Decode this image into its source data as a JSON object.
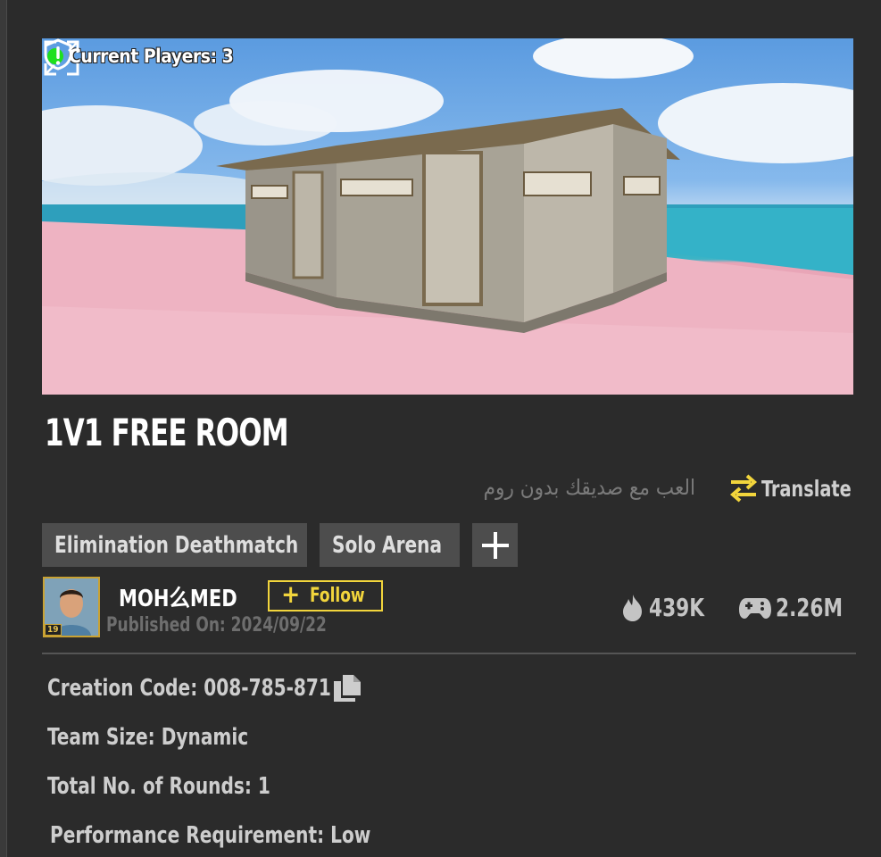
{
  "preview": {
    "current_players_label": "Current Players: 3",
    "status_color": "#1ee01e"
  },
  "room": {
    "title": "1V1 FREE ROOM",
    "description": "العب مع صديقك بدون روم",
    "translate_label": "Translate"
  },
  "tags": [
    "Elimination Deathmatch",
    "Solo Arena"
  ],
  "author": {
    "name": "MOH么MED",
    "follow_label": "Follow",
    "published": "Published On: 2024/09/22",
    "level_badge": "19"
  },
  "stats": {
    "likes": "439K",
    "plays": "2.26M"
  },
  "details": {
    "creation_code": "Creation Code: 008-785-871",
    "team_size": "Team Size: Dynamic",
    "rounds": "Total No. of Rounds: 1",
    "performance": "Performance Requirement: Low"
  },
  "icons": {
    "status": "online-dot-icon",
    "report": "warning-shield-icon",
    "fullscreen": "expand-icon",
    "translate": "swap-arrows-icon",
    "likes": "fire-icon",
    "plays": "gamepad-icon",
    "copy": "copy-icon",
    "add_tag": "plus-icon"
  },
  "colors": {
    "accent_yellow": "#f2d53c",
    "background": "#2b2b2b",
    "tag_bg": "#4d4d4d"
  }
}
